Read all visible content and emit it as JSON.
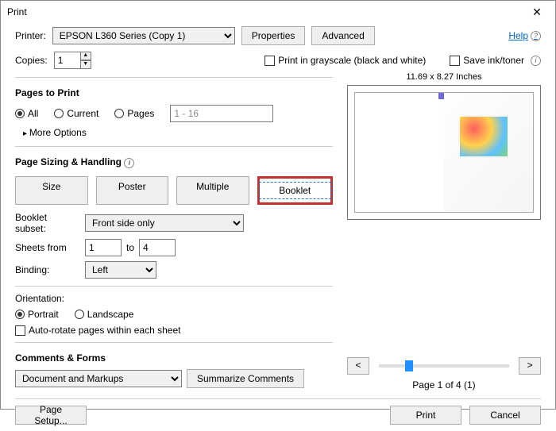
{
  "window": {
    "title": "Print",
    "close": "✕"
  },
  "top": {
    "printer_label": "Printer:",
    "printer_value": "EPSON L360 Series (Copy 1)",
    "properties_btn": "Properties",
    "advanced_btn": "Advanced",
    "help_link": "Help"
  },
  "copies": {
    "label": "Copies:",
    "value": "1",
    "grayscale": "Print in grayscale (black and white)",
    "saveink": "Save ink/toner"
  },
  "pages": {
    "title": "Pages to Print",
    "all": "All",
    "current": "Current",
    "pages": "Pages",
    "range": "1 - 16",
    "more": "More Options"
  },
  "sizing": {
    "title": "Page Sizing & Handling",
    "size": "Size",
    "poster": "Poster",
    "multiple": "Multiple",
    "booklet": "Booklet"
  },
  "booklet": {
    "subset_label": "Booklet subset:",
    "subset_value": "Front side only",
    "sheets_from": "Sheets from",
    "sheets_from_v": "1",
    "to": "to",
    "sheets_to_v": "4",
    "binding_label": "Binding:",
    "binding_value": "Left"
  },
  "orientation": {
    "title": "Orientation:",
    "portrait": "Portrait",
    "landscape": "Landscape",
    "autorotate": "Auto-rotate pages within each sheet"
  },
  "comments": {
    "title": "Comments & Forms",
    "dropdown": "Document and Markups",
    "summarize": "Summarize Comments"
  },
  "preview": {
    "dims": "11.69 x 8.27 Inches",
    "prev": "<",
    "next": ">",
    "page_info": "Page 1 of 4 (1)"
  },
  "footer": {
    "page_setup": "Page Setup...",
    "print": "Print",
    "cancel": "Cancel"
  }
}
